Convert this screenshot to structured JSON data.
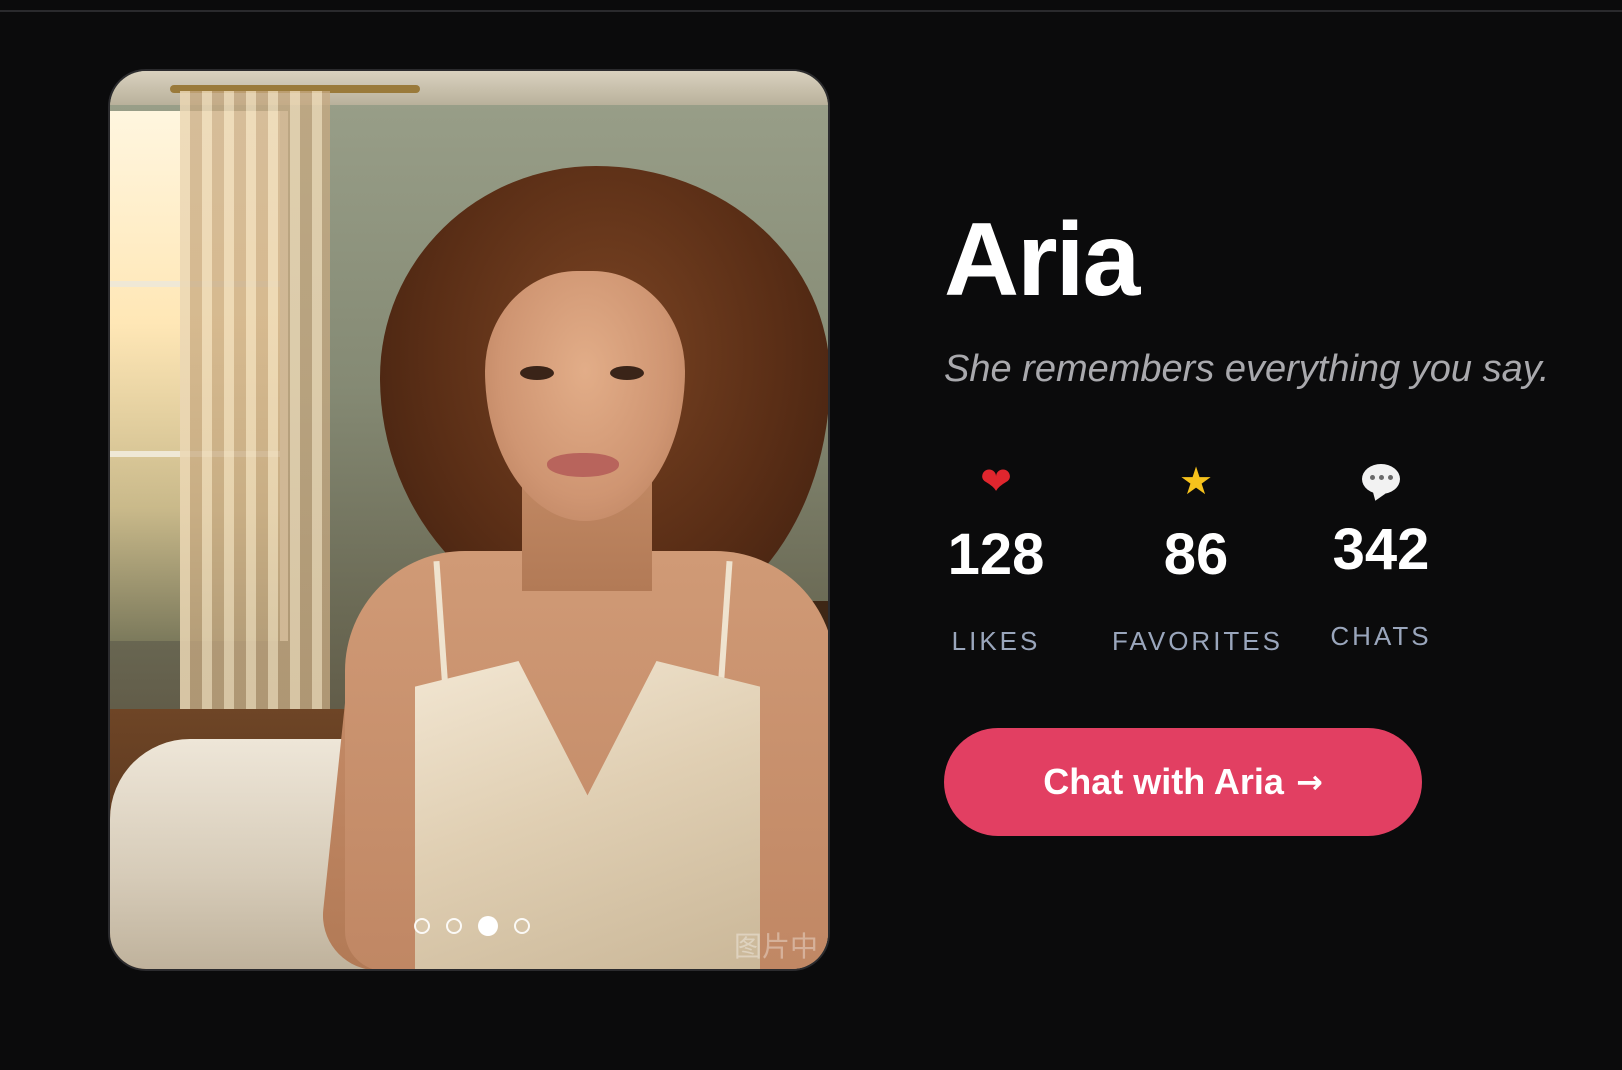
{
  "profile": {
    "name": "Aria",
    "tagline": "She remembers everything you say."
  },
  "gallery": {
    "image_alt": "Aria portrait photo",
    "total_images": 4,
    "active_index": 2,
    "watermark": "图片中"
  },
  "stats": {
    "likes": {
      "icon": "heart-icon",
      "value": "128",
      "label": "LIKES"
    },
    "favorites": {
      "icon": "star-icon",
      "value": "86",
      "label": "FAVORITES"
    },
    "chats": {
      "icon": "speech-bubble-icon",
      "value": "342",
      "label": "CHATS"
    }
  },
  "cta": {
    "label": "Chat with Aria",
    "arrow": "→"
  },
  "colors": {
    "background": "#0b0b0c",
    "accent": "#e23f62",
    "muted_text": "#a9a9ad",
    "stat_label": "#9aa6bc"
  }
}
